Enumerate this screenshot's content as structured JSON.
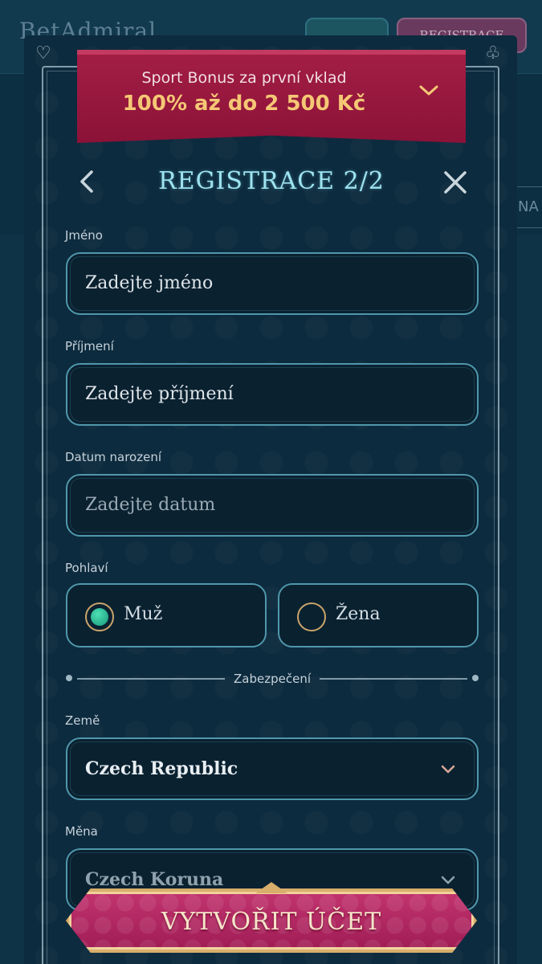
{
  "background": {
    "logo_text": "BetAdmiral",
    "register_button": "REGISTRACE",
    "side_tab": "NA"
  },
  "banner": {
    "subtitle": "Sport Bonus za první vklad",
    "title": "100% až do 2 500 Kč"
  },
  "modal": {
    "title": "REGISTRACE 2/2"
  },
  "form": {
    "first_name": {
      "label": "Jméno",
      "placeholder": "Zadejte jméno"
    },
    "last_name": {
      "label": "Příjmení",
      "placeholder": "Zadejte příjmení"
    },
    "birth_date": {
      "label": "Datum narození",
      "placeholder": "Zadejte datum"
    },
    "gender": {
      "label": "Pohlaví",
      "options": [
        "Muž",
        "Žena"
      ],
      "selected": "Muž"
    },
    "security_divider": "Zabezpečení",
    "country": {
      "label": "Země",
      "value": "Czech Republic"
    },
    "currency": {
      "label": "Měna",
      "value": "Czech Koruna"
    }
  },
  "cta": {
    "label": "VYTVOŘIT ÚČET"
  },
  "colors": {
    "banner": "#9a1a40",
    "banner_title": "#f5c775",
    "title_text": "#9ee3f0",
    "field_border": "#4f97ac",
    "cta": "#b52663",
    "cta_border": "#d8ae6c",
    "radio_selected": "#2fbf96"
  }
}
